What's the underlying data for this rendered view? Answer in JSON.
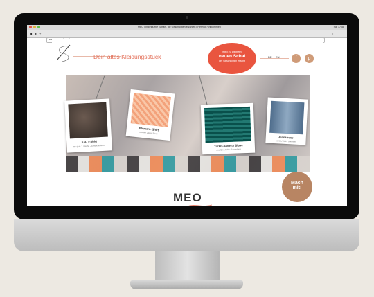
{
  "browser": {
    "window_title": "MEO | Individuelle Schals, die Geschichten erzählen | Herzlich Willkommen",
    "url": "www.meo-schals.de",
    "menubar_right": "Sat 17:58"
  },
  "site": {
    "headline": "Dein altes Kleidungsstück",
    "badge": {
      "line1": "wird zu Deinem",
      "line2": "neuen Schal",
      "line3": "der Geschichten erzählt"
    },
    "language": {
      "de": "DE",
      "sep": "|",
      "en": "EN"
    },
    "social": {
      "facebook": "f",
      "pinterest": "p"
    },
    "products": [
      {
        "title": "XXL T-Shirt",
        "subtitle": "Baujahr 1 / Reihe Jeans Kollektion"
      },
      {
        "title": "Blumen - Shirt",
        "subtitle": "aus der Jacke Shop"
      },
      {
        "title": "Türkis-karierte Bluse",
        "subtitle": "aus Oma Eilles Sammlung"
      },
      {
        "title": "Jeanshose",
        "subtitle": "seit EU 2013 Sommer"
      }
    ],
    "logo": "MEO",
    "cta": {
      "line1": "Mach",
      "line2": "mit!"
    }
  },
  "colors": {
    "accent": "#e36d56",
    "badge": "#e9553f",
    "cta": "#b88563"
  }
}
